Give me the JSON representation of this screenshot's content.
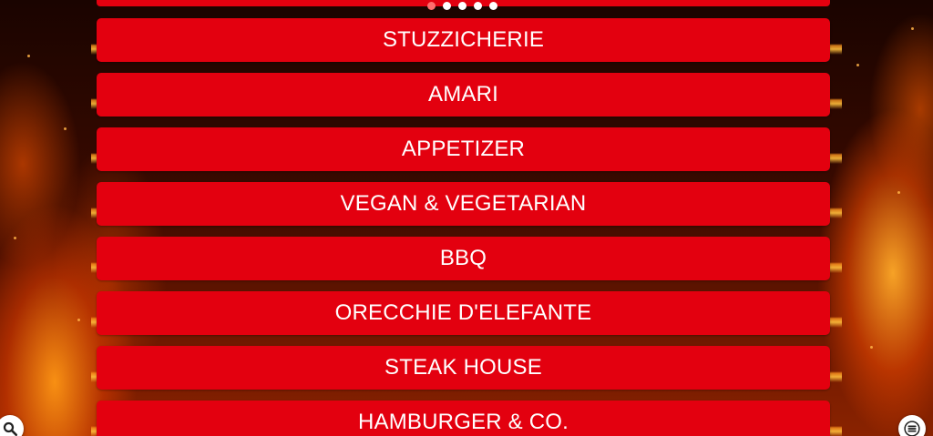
{
  "carousel": {
    "dots": [
      {
        "active": true
      },
      {
        "active": false
      },
      {
        "active": false
      },
      {
        "active": false
      },
      {
        "active": false
      }
    ]
  },
  "menu": {
    "items": [
      {
        "label": "STUZZICHERIE"
      },
      {
        "label": "AMARI"
      },
      {
        "label": "APPETIZER"
      },
      {
        "label": "VEGAN & VEGETARIAN"
      },
      {
        "label": "BBQ"
      },
      {
        "label": "ORECCHIE D'ELEFANTE"
      },
      {
        "label": "STEAK HOUSE"
      },
      {
        "label": "HAMBURGER & CO."
      }
    ]
  },
  "icons": {
    "search": "search-icon",
    "menu": "hamburger-menu-icon"
  },
  "colors": {
    "item_background": "#e3000f",
    "item_text": "#ffffff",
    "active_dot": "#ff6d6d",
    "inactive_dot": "#ffffff"
  }
}
